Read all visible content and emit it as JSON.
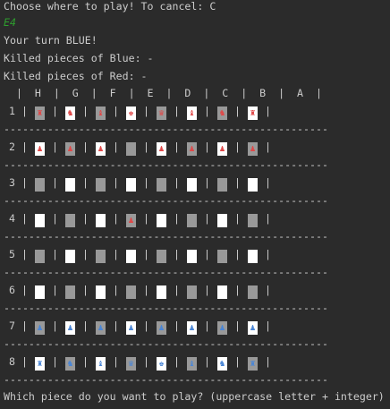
{
  "prompt_top": "Choose where to play! To cancel: C",
  "chosen_square": "E4",
  "turn_text": "Your turn BLUE!",
  "killed_blue": "Killed pieces of Blue: -",
  "killed_red": "Killed pieces of Red: -",
  "header_row": "  |  H  |  G  |  F  |  E  |  D  |  C  |  B  |  A  |",
  "separator": "----------------------------------------------------",
  "row_labels": [
    "1 |",
    "2 |",
    "3 |",
    "4 |",
    "5 |",
    "6 |",
    "7 |",
    "8 |"
  ],
  "board": [
    [
      {
        "c": "gray",
        "p": "♜",
        "s": "red"
      },
      {
        "c": "white",
        "p": "♞",
        "s": "red"
      },
      {
        "c": "gray",
        "p": "♝",
        "s": "red"
      },
      {
        "c": "white",
        "p": "♚",
        "s": "red"
      },
      {
        "c": "gray",
        "p": "♛",
        "s": "red"
      },
      {
        "c": "white",
        "p": "♝",
        "s": "red"
      },
      {
        "c": "gray",
        "p": "♞",
        "s": "red"
      },
      {
        "c": "white",
        "p": "♜",
        "s": "red"
      }
    ],
    [
      {
        "c": "white",
        "p": "♟",
        "s": "red"
      },
      {
        "c": "gray",
        "p": "♟",
        "s": "red"
      },
      {
        "c": "white",
        "p": "♟",
        "s": "red"
      },
      {
        "c": "gray",
        "p": "",
        "s": ""
      },
      {
        "c": "white",
        "p": "♟",
        "s": "red"
      },
      {
        "c": "gray",
        "p": "♟",
        "s": "red"
      },
      {
        "c": "white",
        "p": "♟",
        "s": "red"
      },
      {
        "c": "gray",
        "p": "♟",
        "s": "red"
      }
    ],
    [
      {
        "c": "gray",
        "p": "",
        "s": ""
      },
      {
        "c": "white",
        "p": "",
        "s": ""
      },
      {
        "c": "gray",
        "p": "",
        "s": ""
      },
      {
        "c": "white",
        "p": "",
        "s": ""
      },
      {
        "c": "gray",
        "p": "",
        "s": ""
      },
      {
        "c": "white",
        "p": "",
        "s": ""
      },
      {
        "c": "gray",
        "p": "",
        "s": ""
      },
      {
        "c": "white",
        "p": "",
        "s": ""
      }
    ],
    [
      {
        "c": "white",
        "p": "",
        "s": ""
      },
      {
        "c": "gray",
        "p": "",
        "s": ""
      },
      {
        "c": "white",
        "p": "",
        "s": ""
      },
      {
        "c": "gray",
        "p": "♟",
        "s": "red"
      },
      {
        "c": "white",
        "p": "",
        "s": ""
      },
      {
        "c": "gray",
        "p": "",
        "s": ""
      },
      {
        "c": "white",
        "p": "",
        "s": ""
      },
      {
        "c": "gray",
        "p": "",
        "s": ""
      }
    ],
    [
      {
        "c": "gray",
        "p": "",
        "s": ""
      },
      {
        "c": "white",
        "p": "",
        "s": ""
      },
      {
        "c": "gray",
        "p": "",
        "s": ""
      },
      {
        "c": "white",
        "p": "",
        "s": ""
      },
      {
        "c": "gray",
        "p": "",
        "s": ""
      },
      {
        "c": "white",
        "p": "",
        "s": ""
      },
      {
        "c": "gray",
        "p": "",
        "s": ""
      },
      {
        "c": "white",
        "p": "",
        "s": ""
      }
    ],
    [
      {
        "c": "white",
        "p": "",
        "s": ""
      },
      {
        "c": "gray",
        "p": "",
        "s": ""
      },
      {
        "c": "white",
        "p": "",
        "s": ""
      },
      {
        "c": "gray",
        "p": "",
        "s": ""
      },
      {
        "c": "white",
        "p": "",
        "s": ""
      },
      {
        "c": "gray",
        "p": "",
        "s": ""
      },
      {
        "c": "white",
        "p": "",
        "s": ""
      },
      {
        "c": "gray",
        "p": "",
        "s": ""
      }
    ],
    [
      {
        "c": "gray",
        "p": "♟",
        "s": "blue"
      },
      {
        "c": "white",
        "p": "♟",
        "s": "blue"
      },
      {
        "c": "gray",
        "p": "♟",
        "s": "blue"
      },
      {
        "c": "white",
        "p": "♟",
        "s": "blue"
      },
      {
        "c": "gray",
        "p": "♟",
        "s": "blue"
      },
      {
        "c": "white",
        "p": "♟",
        "s": "blue"
      },
      {
        "c": "gray",
        "p": "♟",
        "s": "blue"
      },
      {
        "c": "white",
        "p": "♟",
        "s": "blue"
      }
    ],
    [
      {
        "c": "white",
        "p": "♜",
        "s": "blue"
      },
      {
        "c": "gray",
        "p": "♞",
        "s": "blue"
      },
      {
        "c": "white",
        "p": "♝",
        "s": "blue"
      },
      {
        "c": "gray",
        "p": "♛",
        "s": "blue"
      },
      {
        "c": "white",
        "p": "♚",
        "s": "blue"
      },
      {
        "c": "gray",
        "p": "♝",
        "s": "blue"
      },
      {
        "c": "white",
        "p": "♞",
        "s": "blue"
      },
      {
        "c": "gray",
        "p": "♜",
        "s": "blue"
      }
    ]
  ],
  "bottom_prompt": "Which piece do you want to play? (uppercase letter + integer)"
}
